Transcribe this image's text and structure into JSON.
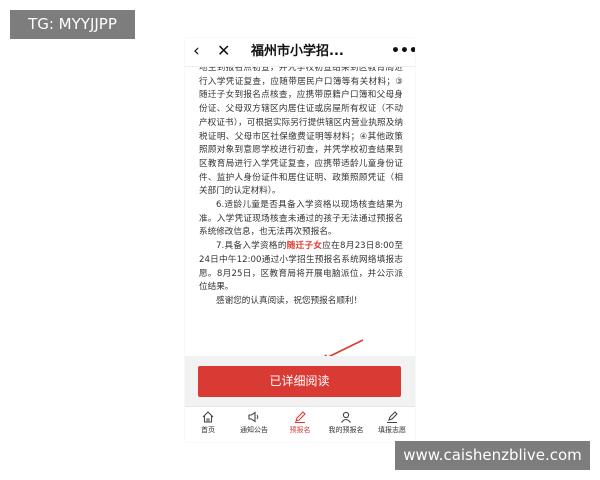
{
  "watermarks": {
    "top_left": "TG: MYYJJPP",
    "bottom_right": "www.caishenzblive.com"
  },
  "topbar": {
    "back_icon": "‹",
    "close_icon": "✕",
    "title": "福州市小学招...",
    "more_icon": "•••"
  },
  "article": {
    "para1": "地生到报名点初查，并凭学校初查结果到区教育局进行入学凭证复查，应随带居民户口簿等有关材料；③随迁子女到报名点核查，应携带原籍户口簿和父母身份证、父母双方辖区内居住证或房屋所有权证（不动产权证书），可根据实际另行提供辖区内营业执照及纳税证明、父母市区社保缴费证明等材料；④其他政策照顾对象到意愿学校进行初查，并凭学校初查结果到区教育局进行入学凭证复查，应携带适龄儿童身份证件、监护人身份证件和居住证明、政策照顾凭证（相关部门的认定材料）。",
    "para2": "6.适龄儿童是否具备入学资格以现场核查结果为准。入学凭证现场核查未通过的孩子无法通过预报名系统修改信息，也无法再次预报名。",
    "para3_before": "7.具备入学资格的",
    "para3_highlight": "随迁子女",
    "para3_after": "应在8月23日8:00至24日中午12:00通过小学招生预报名系统网络填报志愿。8月25日，区教育局将开展电脑派位，并公示派位结果。",
    "para4": "感谢您的认真阅读，祝您预报名顺利！"
  },
  "confirm_button": {
    "label": "已详细阅读"
  },
  "tabbar": {
    "items": [
      {
        "label": "首页",
        "icon": "home-icon"
      },
      {
        "label": "通知公告",
        "icon": "speaker-icon"
      },
      {
        "label": "预报名",
        "icon": "pen-icon",
        "active": true
      },
      {
        "label": "我的预报名",
        "icon": "user-icon"
      },
      {
        "label": "填报志愿",
        "icon": "edit-icon"
      }
    ]
  },
  "colors": {
    "accent": "#d93a34",
    "highlight": "#e03b2f",
    "watermark_bg": "#7d7d7d"
  }
}
